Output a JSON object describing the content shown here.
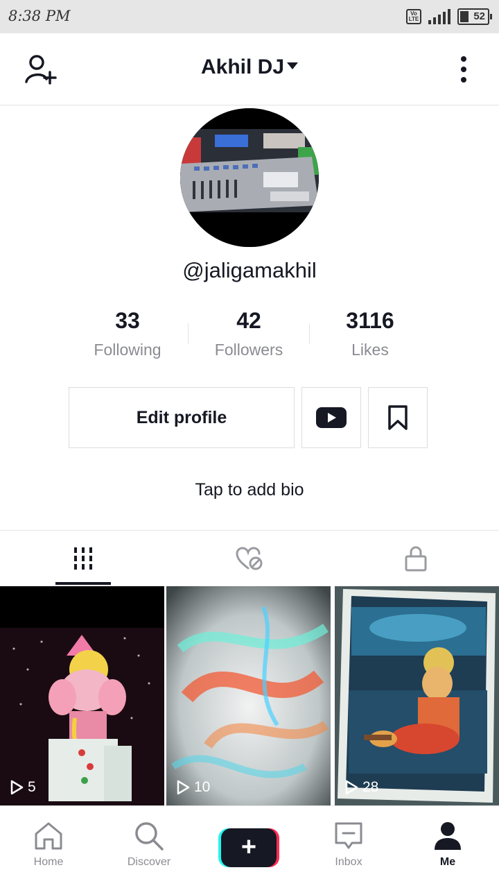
{
  "status_bar": {
    "time": "8:38 PM",
    "network_label": "VoLTE",
    "battery": "52"
  },
  "header": {
    "title": "Akhil DJ",
    "add_user_icon": "add-user-icon",
    "more_icon": "more-vertical-icon"
  },
  "profile": {
    "username": "@jaligamakhil",
    "stats": [
      {
        "value": "33",
        "label": "Following"
      },
      {
        "value": "42",
        "label": "Followers"
      },
      {
        "value": "3116",
        "label": "Likes"
      }
    ],
    "edit_label": "Edit profile",
    "youtube_icon": "youtube-icon",
    "bookmark_icon": "bookmark-icon",
    "bio_prompt": "Tap to add bio"
  },
  "tabs": [
    {
      "icon": "videos-grid-icon",
      "active": true
    },
    {
      "icon": "liked-heart-icon",
      "active": false
    },
    {
      "icon": "lock-icon",
      "active": false
    }
  ],
  "videos": [
    {
      "plays": "5"
    },
    {
      "plays": "10"
    },
    {
      "plays": "28"
    }
  ],
  "bottom_nav": [
    {
      "label": "Home",
      "icon": "home-icon"
    },
    {
      "label": "Discover",
      "icon": "search-icon"
    },
    {
      "label": "",
      "icon": "create-plus-icon"
    },
    {
      "label": "Inbox",
      "icon": "inbox-icon"
    },
    {
      "label": "Me",
      "icon": "profile-icon",
      "active": true
    }
  ],
  "colors": {
    "text": "#161823",
    "muted": "#8a8b91",
    "accent_pink": "#fe2c55",
    "accent_cyan": "#25f4ee"
  }
}
